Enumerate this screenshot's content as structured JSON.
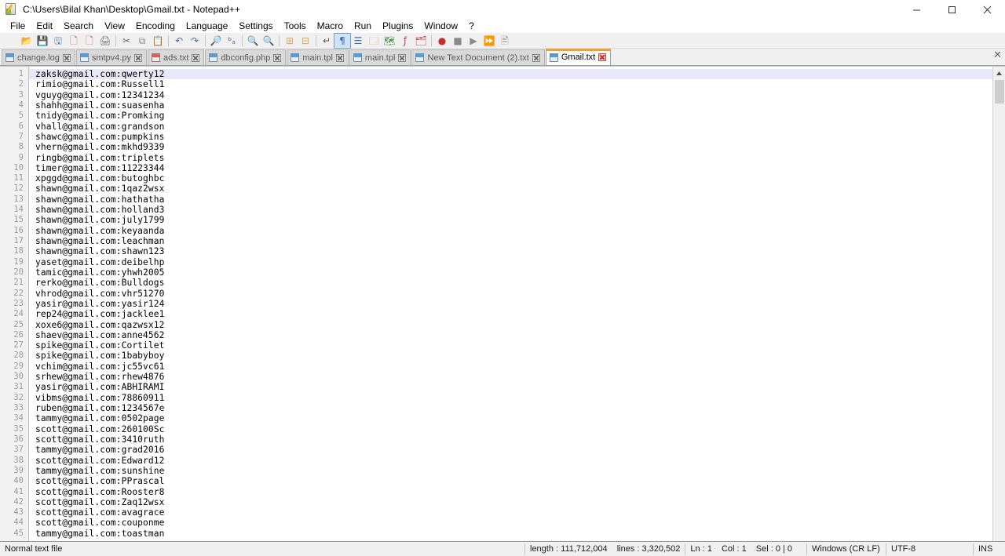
{
  "window": {
    "title": "C:\\Users\\Bilal Khan\\Desktop\\Gmail.txt - Notepad++",
    "app_icon": "notepad-plus-plus-icon",
    "minimize_label": "─",
    "maximize_label": "□",
    "close_label": "✕",
    "doc_close_label": "✕"
  },
  "menubar": {
    "items": [
      {
        "label": "File"
      },
      {
        "label": "Edit"
      },
      {
        "label": "Search"
      },
      {
        "label": "View"
      },
      {
        "label": "Encoding"
      },
      {
        "label": "Language"
      },
      {
        "label": "Settings"
      },
      {
        "label": "Tools"
      },
      {
        "label": "Macro"
      },
      {
        "label": "Run"
      },
      {
        "label": "Plugins"
      },
      {
        "label": "Window"
      },
      {
        "label": "?"
      }
    ]
  },
  "toolbar": {
    "buttons": [
      {
        "name": "new-file-icon",
        "glyph": "🗋",
        "color": "#f0f0f0"
      },
      {
        "name": "open-file-icon",
        "glyph": "📂",
        "color": "#e8a13a"
      },
      {
        "name": "save-icon",
        "glyph": "💾",
        "color": "#8a8a8a"
      },
      {
        "name": "save-all-icon",
        "glyph": "🖫",
        "color": "#5b8fc9"
      },
      {
        "name": "close-file-icon",
        "glyph": "🗋",
        "color": "#d04a4a"
      },
      {
        "name": "close-all-files-icon",
        "glyph": "🗋",
        "color": "#d04a4a"
      },
      {
        "name": "print-icon",
        "glyph": "🖨",
        "color": "#7a7a7a"
      },
      {
        "name": "separator",
        "glyph": "",
        "color": ""
      },
      {
        "name": "cut-icon",
        "glyph": "✂",
        "color": "#6a6a6a"
      },
      {
        "name": "copy-icon",
        "glyph": "⧉",
        "color": "#8a8a8a"
      },
      {
        "name": "paste-icon",
        "glyph": "📋",
        "color": "#d8a85a"
      },
      {
        "name": "separator",
        "glyph": "",
        "color": ""
      },
      {
        "name": "undo-icon",
        "glyph": "↶",
        "color": "#4a6fa5"
      },
      {
        "name": "redo-icon",
        "glyph": "↷",
        "color": "#4a6fa5"
      },
      {
        "name": "separator",
        "glyph": "",
        "color": ""
      },
      {
        "name": "find-icon",
        "glyph": "🔎",
        "color": "#3a3a3a"
      },
      {
        "name": "replace-icon",
        "glyph": "ᵇₐ",
        "color": "#4a6fa5"
      },
      {
        "name": "separator",
        "glyph": "",
        "color": ""
      },
      {
        "name": "zoom-in-icon",
        "glyph": "🔍",
        "color": "#4a9a4a"
      },
      {
        "name": "zoom-out-icon",
        "glyph": "🔍",
        "color": "#c04a4a"
      },
      {
        "name": "separator",
        "glyph": "",
        "color": ""
      },
      {
        "name": "sync-vertical-scroll-icon",
        "glyph": "⊞",
        "color": "#d8a85a"
      },
      {
        "name": "sync-horizontal-scroll-icon",
        "glyph": "⊟",
        "color": "#d8a85a"
      },
      {
        "name": "separator",
        "glyph": "",
        "color": ""
      },
      {
        "name": "word-wrap-icon",
        "glyph": "↵",
        "color": "#5a5a5a"
      },
      {
        "name": "show-all-characters-icon",
        "glyph": "¶",
        "color": "#3a6ea5"
      },
      {
        "name": "indent-guide-icon",
        "glyph": "☰",
        "color": "#3a6ea5"
      },
      {
        "name": "user-defined-language-icon",
        "glyph": "🗔",
        "color": "#d8a85a"
      },
      {
        "name": "document-map-icon",
        "glyph": "🗺",
        "color": "#4a9a4a"
      },
      {
        "name": "function-list-icon",
        "glyph": "ƒ",
        "color": "#c04a4a"
      },
      {
        "name": "document-list-icon",
        "glyph": "🗂",
        "color": "#d04a4a"
      },
      {
        "name": "separator",
        "glyph": "",
        "color": ""
      },
      {
        "name": "macro-record-icon",
        "glyph": "●",
        "color": "#c03030"
      },
      {
        "name": "macro-stop-icon",
        "glyph": "■",
        "color": "#8a8a8a"
      },
      {
        "name": "macro-play-icon",
        "glyph": "▶",
        "color": "#8a8a8a"
      },
      {
        "name": "macro-run-multiple-icon",
        "glyph": "⏩",
        "color": "#3a6ea5"
      },
      {
        "name": "run-macro-dialog-icon",
        "glyph": "🖹",
        "color": "#8a8a8a"
      }
    ]
  },
  "tabs": [
    {
      "label": "change.log",
      "modified": false,
      "active": false
    },
    {
      "label": "smtpv4.py",
      "modified": false,
      "active": false
    },
    {
      "label": "ads.txt",
      "modified": true,
      "active": false
    },
    {
      "label": "dbconfig.php",
      "modified": false,
      "active": false
    },
    {
      "label": "main.tpl",
      "modified": false,
      "active": false
    },
    {
      "label": "main.tpl",
      "modified": false,
      "active": false
    },
    {
      "label": "New Text Document (2).txt",
      "modified": false,
      "active": false
    },
    {
      "label": "Gmail.txt",
      "modified": false,
      "active": true
    }
  ],
  "editor": {
    "current_line": 1,
    "lines": [
      "zaksk@gmail.com:qwerty12",
      "rimio@gmail.com:Russell1",
      "vguyg@gmail.com:12341234",
      "shahh@gmail.com:suasenha",
      "tnidy@gmail.com:Promking",
      "vhall@gmail.com:grandson",
      "shawc@gmail.com:pumpkins",
      "vhern@gmail.com:mkhd9339",
      "ringb@gmail.com:triplets",
      "timer@gmail.com:11223344",
      "xpggd@gmail.com:butoghbc",
      "shawn@gmail.com:1qaz2wsx",
      "shawn@gmail.com:hathatha",
      "shawn@gmail.com:holland3",
      "shawn@gmail.com:july1799",
      "shawn@gmail.com:keyaanda",
      "shawn@gmail.com:leachman",
      "shawn@gmail.com:shawn123",
      "yaset@gmail.com:deibelhp",
      "tamic@gmail.com:yhwh2005",
      "rerko@gmail.com:Bulldogs",
      "vhrod@gmail.com:vhr51270",
      "yasir@gmail.com:yasir124",
      "rep24@gmail.com:jacklee1",
      "xoxe6@gmail.com:qazwsx12",
      "shaev@gmail.com:anne4562",
      "spike@gmail.com:Cortilet",
      "spike@gmail.com:1babyboy",
      "vchim@gmail.com:jc55vc61",
      "srhew@gmail.com:rhew4876",
      "yasir@gmail.com:ABHIRAMI",
      "vibms@gmail.com:78860911",
      "ruben@gmail.com:1234567e",
      "tammy@gmail.com:0502page",
      "scott@gmail.com:260100Sc",
      "scott@gmail.com:3410ruth",
      "tammy@gmail.com:grad2016",
      "scott@gmail.com:Edward12",
      "tammy@gmail.com:sunshine",
      "scott@gmail.com:PPrascal",
      "scott@gmail.com:Rooster8",
      "scott@gmail.com:Zaq12wsx",
      "scott@gmail.com:avagrace",
      "scott@gmail.com:couponme",
      "tammy@gmail.com:toastman"
    ]
  },
  "statusbar": {
    "doc_type": "Normal text file",
    "length": "length : 111,712,004",
    "lines": "lines : 3,320,502",
    "ln": "Ln : 1",
    "col": "Col : 1",
    "sel": "Sel : 0 | 0",
    "eol": "Windows (CR LF)",
    "encoding": "UTF-8",
    "insert_mode": "INS"
  },
  "colors": {
    "accent_tab": "#f0a030",
    "current_line_highlight": "#e8e8f8",
    "gutter_bg": "#f2f2f2",
    "chrome_bg": "#f0f0f0"
  }
}
